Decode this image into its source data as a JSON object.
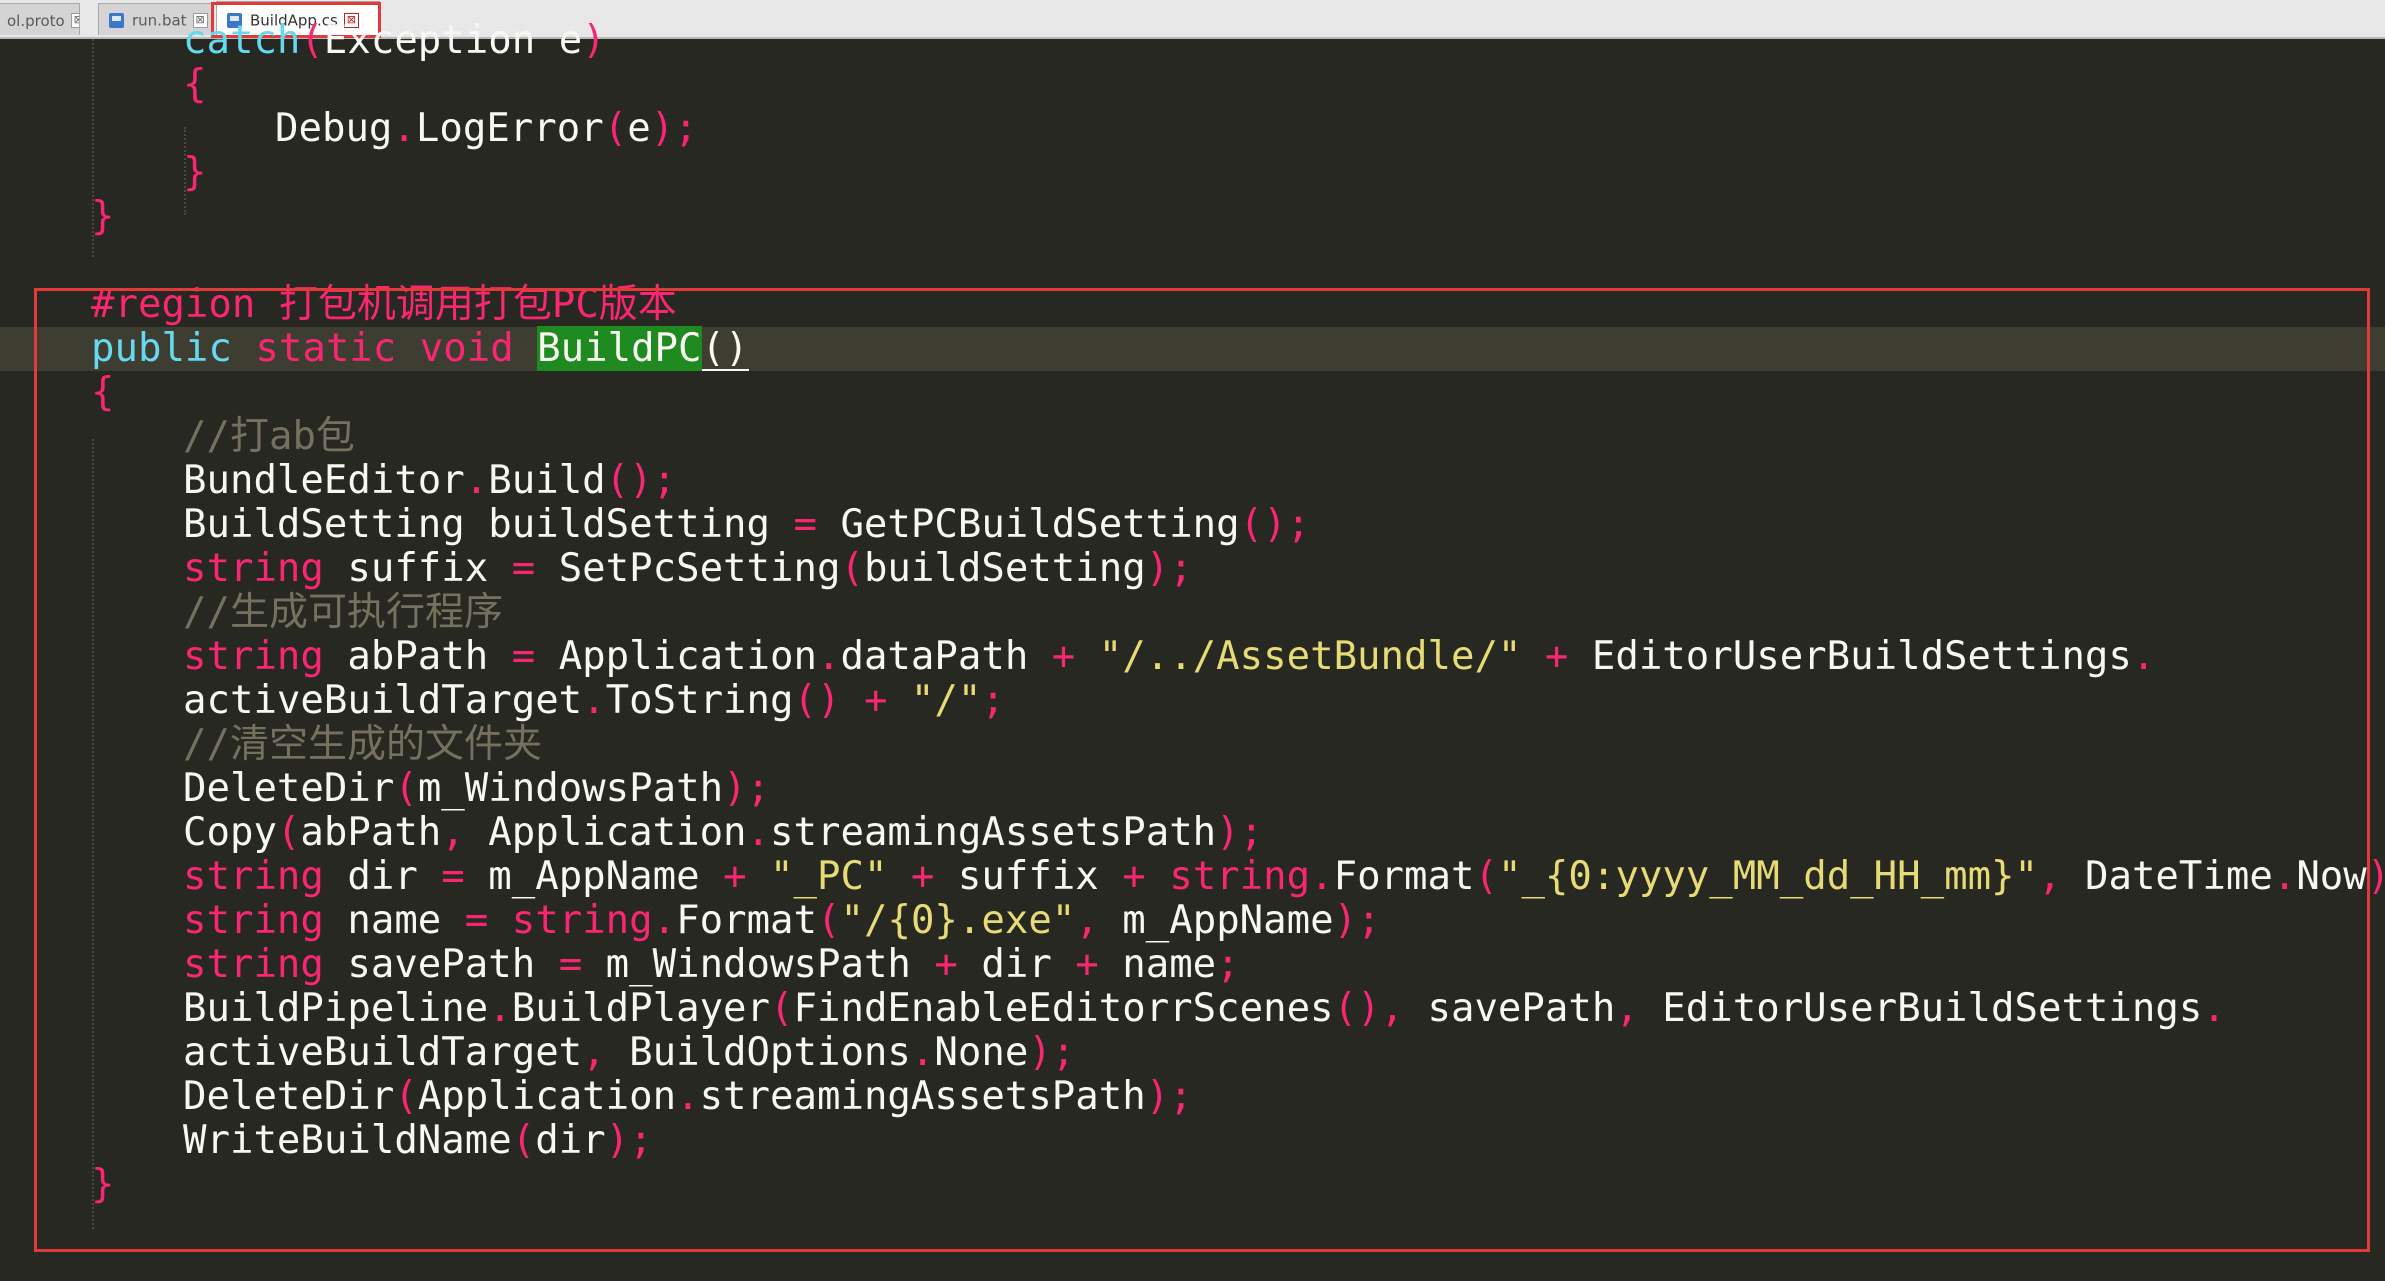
{
  "tabs": [
    {
      "label": "ol.proto",
      "active": false
    },
    {
      "label": "run.bat",
      "active": false
    },
    {
      "label": "BuildApp.cs",
      "active": true
    }
  ],
  "tab_close_glyph": "⊠",
  "highlight_color": "#e03a3a",
  "syntax_colors": {
    "keyword": "#f92672",
    "type": "#66d9ef",
    "string": "#e6db74",
    "comment": "#75715e",
    "text": "#f8f8f2",
    "selection": "#1f8a1f",
    "background": "#272822"
  },
  "code": {
    "l01": [
      "catch",
      "(",
      "Exception e",
      ")"
    ],
    "l02": [
      "{"
    ],
    "l03": [
      "Debug",
      ".",
      "LogError",
      "(",
      "e",
      ");"
    ],
    "l04": [
      "}"
    ],
    "l05": [
      "}"
    ],
    "l06": [
      "#region 打包机调用打包PC版本"
    ],
    "l07": [
      "public",
      " ",
      "static",
      " ",
      "void",
      " ",
      "BuildPC",
      "(",
      ")"
    ],
    "l08": [
      "{"
    ],
    "l09": [
      "//打ab包"
    ],
    "l10": [
      "BundleEditor",
      ".",
      "Build",
      "();"
    ],
    "l11": [
      "BuildSetting buildSetting ",
      "=",
      " GetPCBuildSetting",
      "();"
    ],
    "l12": [
      "string",
      " suffix ",
      "=",
      " SetPcSetting",
      "(",
      "buildSetting",
      ");"
    ],
    "l13": [
      "//生成可执行程序"
    ],
    "l14": [
      "string",
      " abPath ",
      "=",
      " Application",
      ".",
      "dataPath ",
      "+",
      " ",
      "\"/../AssetBundle/\"",
      " ",
      "+",
      " EditorUserBuildSettings",
      "."
    ],
    "l15": [
      "activeBuildTarget",
      ".",
      "ToString",
      "()",
      " ",
      "+",
      " ",
      "\"/\"",
      ";"
    ],
    "l16": [
      "//清空生成的文件夹"
    ],
    "l17": [
      "DeleteDir",
      "(",
      "m_WindowsPath",
      ");"
    ],
    "l18": [
      "Copy",
      "(",
      "abPath",
      ",",
      " Application",
      ".",
      "streamingAssetsPath",
      ");"
    ],
    "l19": [
      "string",
      " dir ",
      "=",
      " m_AppName ",
      "+",
      " ",
      "\"_PC\"",
      " ",
      "+",
      " suffix ",
      "+",
      " ",
      "string",
      ".",
      "Format",
      "(",
      "\"_{0:yyyy_MM_dd_HH_mm}\"",
      ",",
      " DateTime",
      ".",
      "Now",
      ");"
    ],
    "l20": [
      "string",
      " name ",
      "=",
      " ",
      "string",
      ".",
      "Format",
      "(",
      "\"/{0}.exe\"",
      ",",
      " m_AppName",
      ");"
    ],
    "l21": [
      "string",
      " savePath ",
      "=",
      " m_WindowsPath ",
      "+",
      " dir ",
      "+",
      " name",
      ";"
    ],
    "l22": [
      "BuildPipeline",
      ".",
      "BuildPlayer",
      "(",
      "FindEnableEditorrScenes",
      "()",
      ",",
      " savePath",
      ",",
      " EditorUserBuildSettings",
      "."
    ],
    "l23": [
      "activeBuildTarget",
      ",",
      " BuildOptions",
      ".",
      "None",
      ");"
    ],
    "l24": [
      "DeleteDir",
      "(",
      "Application",
      ".",
      "streamingAssetsPath",
      ");"
    ],
    "l25": [
      "WriteBuildName",
      "(",
      "dir",
      ");"
    ],
    "l26": [
      "}"
    ]
  }
}
